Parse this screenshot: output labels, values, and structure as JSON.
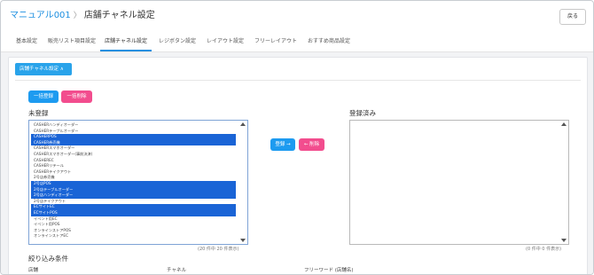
{
  "header": {
    "breadcrumb_parent": "マニュアル001",
    "breadcrumb_separator": "〉",
    "page_title": "店舗チャネル設定",
    "back_label": "戻る"
  },
  "tabs": [
    {
      "label": "基本設定"
    },
    {
      "label": "販売リスト項目設定"
    },
    {
      "label": "店舗チャネル設定"
    },
    {
      "label": "レジボタン設定"
    },
    {
      "label": "レイアウト設定"
    },
    {
      "label": "フリーレイアウト"
    },
    {
      "label": "おすすめ商品設定"
    }
  ],
  "active_tab": "店舗チャネル設定",
  "section": {
    "toggle_label": "店舗チャネル設定 ∧"
  },
  "bulk": {
    "register_label": "一括登録",
    "delete_label": "一括削除"
  },
  "unregistered": {
    "title": "未登録",
    "count_note": "(20 件中 20 件表示)",
    "options": [
      {
        "label": "CASHERハンディオーダー",
        "selected": false
      },
      {
        "label": "CASHERテーブルオーダー",
        "selected": false
      },
      {
        "label": "CASHERPOS",
        "selected": true
      },
      {
        "label": "CASHER券売機",
        "selected": true
      },
      {
        "label": "CASHERスマホオーダー",
        "selected": false
      },
      {
        "label": "CASHERスマホオーダー(事前決済)",
        "selected": false
      },
      {
        "label": "CASHEREC",
        "selected": false
      },
      {
        "label": "CASHERリテール",
        "selected": false
      },
      {
        "label": "CASHERテイクアウト",
        "selected": false
      },
      {
        "label": "2号店券売機",
        "selected": false
      },
      {
        "label": "2号店POS",
        "selected": true
      },
      {
        "label": "2号店テーブルオーダー",
        "selected": true
      },
      {
        "label": "2号店ハンディオーダー",
        "selected": true
      },
      {
        "label": "2号店テイクアウト",
        "selected": false
      },
      {
        "label": "ECサイトEC",
        "selected": true
      },
      {
        "label": "ECサイトPOS",
        "selected": true
      },
      {
        "label": "イベント用EC",
        "selected": false
      },
      {
        "label": "イベント用POS",
        "selected": false
      },
      {
        "label": "オンラインストアPOS",
        "selected": false
      },
      {
        "label": "オンラインストアEC",
        "selected": false
      }
    ]
  },
  "transfer": {
    "register_label": "登録 →",
    "delete_label": "← 削除"
  },
  "registered": {
    "title": "登録済み",
    "count_note": "(0 件中 0 件表示)",
    "options": []
  },
  "filter": {
    "title": "絞り込み条件",
    "store_label": "店舗",
    "channel_label": "チャネル",
    "freeword_label": "フリーワード (店舗名)"
  },
  "colors": {
    "accent": "#1d9bf0",
    "danger": "#f24d8e",
    "selection": "#1a64d6",
    "link": "#1d8fe0"
  }
}
